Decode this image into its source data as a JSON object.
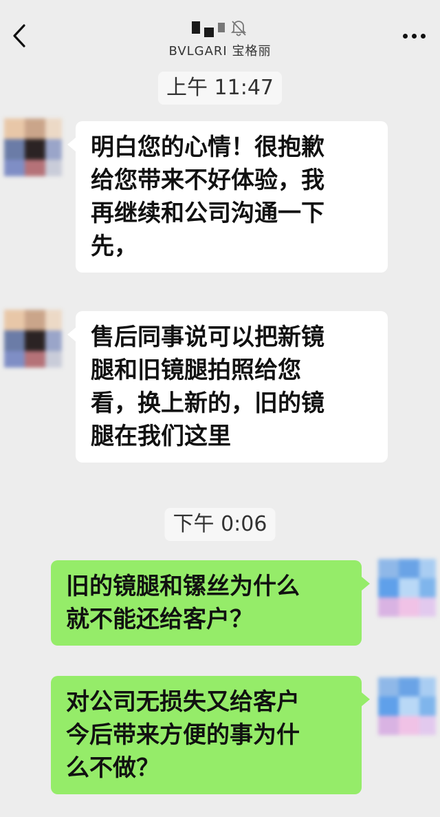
{
  "header": {
    "subtitle": "BVLGARI 宝格丽",
    "back_icon": "chevron-left-icon",
    "more_icon": "more-dots-icon",
    "mute_icon": "bell-off-icon"
  },
  "messages": [
    {
      "type": "time",
      "text": "上午 11:47"
    },
    {
      "type": "received",
      "lines": [
        "明白您的心情！很抱歉",
        "给您带来不好体验，我",
        "再继续和公司沟通一下",
        "先，"
      ]
    },
    {
      "type": "received",
      "lines": [
        "售后同事说可以把新镜",
        "腿和旧镜腿拍照给您",
        "看，换上新的，旧的镜",
        "腿在我们这里"
      ]
    },
    {
      "type": "time",
      "text": "下午 0:06"
    },
    {
      "type": "sent",
      "lines": [
        "旧的镜腿和镙丝为什么",
        "就不能还给客户？"
      ]
    },
    {
      "type": "sent",
      "lines": [
        "对公司无损失又给客户",
        "今后带来方便的事为什",
        "么不做？"
      ]
    }
  ],
  "colors": {
    "background": "#ededed",
    "sent_bubble": "#95ec69",
    "received_bubble": "#ffffff",
    "time_bg": "#f7f7f7"
  }
}
